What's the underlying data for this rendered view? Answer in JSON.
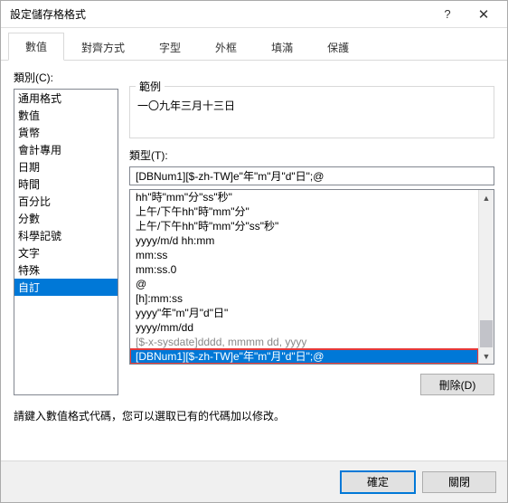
{
  "window": {
    "title": "設定儲存格格式"
  },
  "tabs": [
    "數值",
    "對齊方式",
    "字型",
    "外框",
    "填滿",
    "保護"
  ],
  "activeTab": 0,
  "categoryLabel": "類別(C):",
  "categories": [
    "通用格式",
    "數值",
    "貨幣",
    "會計專用",
    "日期",
    "時間",
    "百分比",
    "分數",
    "科學記號",
    "文字",
    "特殊",
    "自訂"
  ],
  "selectedCategoryIndex": 11,
  "sample": {
    "label": "範例",
    "text": "一〇九年三月十三日"
  },
  "typeLabel": "類型(T):",
  "typeInputValue": "[DBNum1][$-zh-TW]e\"年\"m\"月\"d\"日\";@",
  "typeItems": [
    "hh\"時\"mm\"分\"ss\"秒\"",
    "上午/下午hh\"時\"mm\"分\"",
    "上午/下午hh\"時\"mm\"分\"ss\"秒\"",
    "yyyy/m/d hh:mm",
    "mm:ss",
    "mm:ss.0",
    "@",
    "[h]:mm:ss",
    "yyyy\"年\"m\"月\"d\"日\"",
    "yyyy/mm/dd",
    "[$-x-sysdate]dddd, mmmm dd, yyyy",
    "[DBNum1][$-zh-TW]e\"年\"m\"月\"d\"日\";@"
  ],
  "dimmedIndex": 10,
  "selectedTypeIndex": 11,
  "deleteLabel": "刪除(D)",
  "hint": "請鍵入數值格式代碼，您可以選取已有的代碼加以修改。",
  "footer": {
    "ok": "確定",
    "cancel": "關閉"
  }
}
